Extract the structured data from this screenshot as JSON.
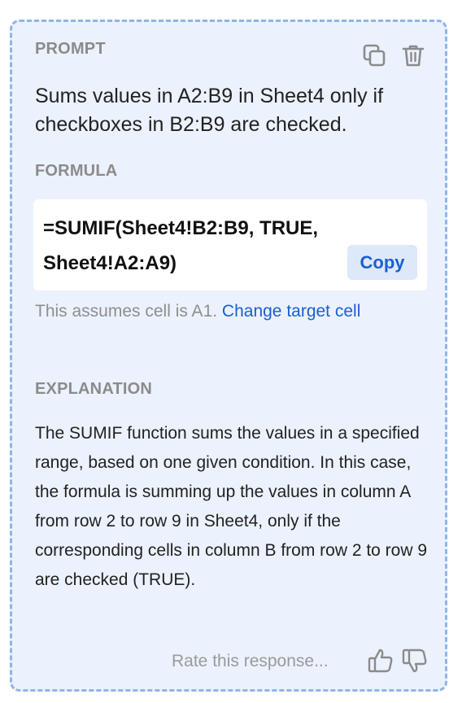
{
  "prompt": {
    "label": "PROMPT",
    "text": "Sums values in A2:B9 in Sheet4 only if checkboxes in B2:B9 are checked."
  },
  "formula": {
    "label": "FORMULA",
    "code": "=SUMIF(Sheet4!B2:B9, TRUE, Sheet4!A2:A9)",
    "copy_label": "Copy",
    "assume_text": "This assumes cell is A1. ",
    "change_link": "Change target cell"
  },
  "explanation": {
    "label": "EXPLANATION",
    "text": "The SUMIF function sums the values in a specified range, based on one given condition. In this case, the formula is summing up the values in column A from row 2 to row 9 in Sheet4, only if the corresponding cells in column B from row 2 to row 9 are checked (TRUE)."
  },
  "rating": {
    "prompt_text": "Rate this response..."
  },
  "icons": {
    "copy": "duplicate-icon",
    "delete": "trash-icon",
    "thumbs_up": "thumbs-up-icon",
    "thumbs_down": "thumbs-down-icon"
  },
  "colors": {
    "card_background": "#ebf2fd",
    "card_border": "#8fb5ea",
    "link": "#1b5fd0",
    "label": "#8b8b8b"
  }
}
